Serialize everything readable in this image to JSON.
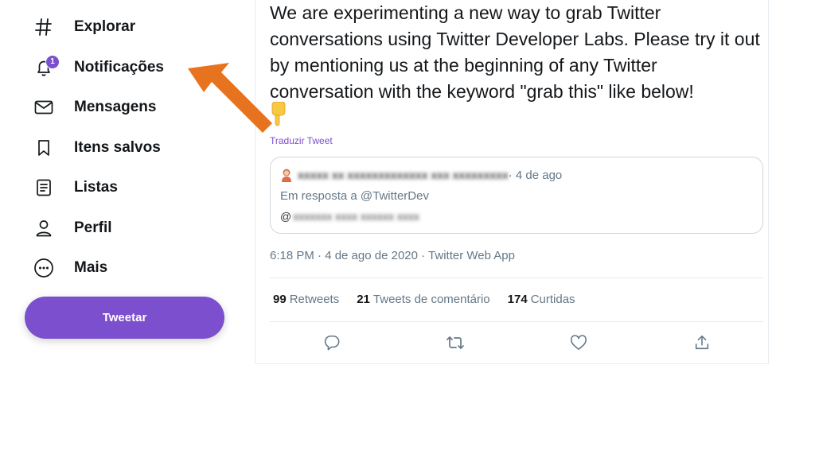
{
  "sidebar": {
    "items": [
      {
        "label": "Explorar",
        "icon": "hashtag-icon"
      },
      {
        "label": "Notificações",
        "icon": "bell-icon",
        "badge": "1"
      },
      {
        "label": "Mensagens",
        "icon": "mail-icon"
      },
      {
        "label": "Itens salvos",
        "icon": "bookmark-icon"
      },
      {
        "label": "Listas",
        "icon": "list-icon"
      },
      {
        "label": "Perfil",
        "icon": "person-icon"
      },
      {
        "label": "Mais",
        "icon": "more-icon"
      }
    ],
    "tweet_button": "Tweetar"
  },
  "tweet": {
    "text": "We are experimenting a new way to grab Twitter conversations using Twitter Developer Labs.  Please try it out by mentioning us at the beginning of any Twitter conversation with the keyword \"grab this\" like below!",
    "translate": "Traduzir Tweet",
    "quote": {
      "date": "· 4 de ago",
      "reply_to": "Em resposta a @TwitterDev",
      "text_prefix": "@"
    },
    "meta": "6:18 PM · 4 de ago de 2020 · Twitter Web App",
    "stats": [
      {
        "count": "99",
        "label": "Retweets"
      },
      {
        "count": "21",
        "label": "Tweets de comentário"
      },
      {
        "count": "174",
        "label": "Curtidas"
      }
    ]
  },
  "colors": {
    "accent": "#7b4fce",
    "annotation_arrow": "#e8731f"
  }
}
